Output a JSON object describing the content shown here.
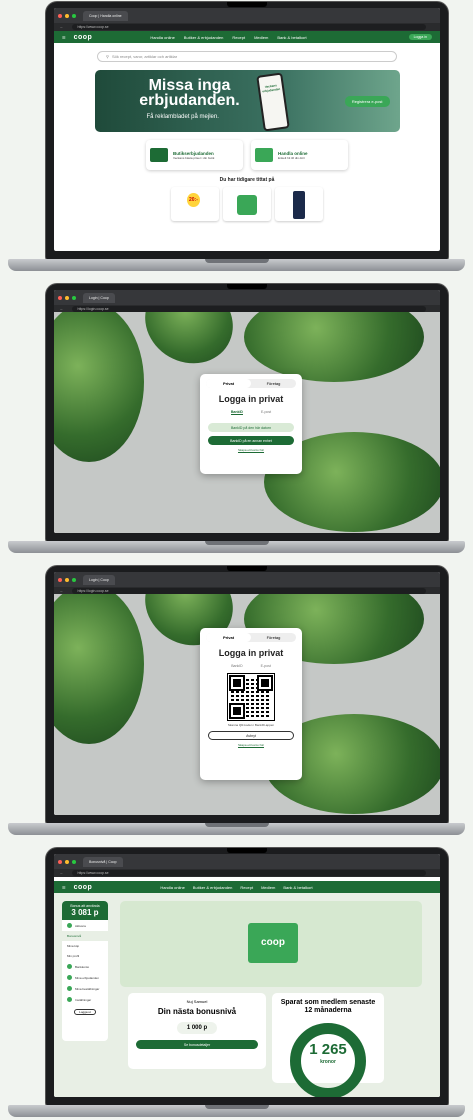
{
  "screen1": {
    "tab": "Coop | Handla online",
    "url": "https://www.coop.se",
    "logo": "coop",
    "nav": [
      "Handla online",
      "Butiker & erbjudanden",
      "Recept",
      "Medlem",
      "Bank & betalkort"
    ],
    "login": "Logga in",
    "search_placeholder": "Sök recept, varor, artiklar och artiklar",
    "hero_title": "Missa inga erbjudanden.",
    "hero_sub": "Få reklambladet på mejlen.",
    "hero_button": "Registrera e-post",
    "phone_text": "Veckans erbjudanden",
    "card1_title": "Butikserbjudanden",
    "card1_sub": "Veckans bästa priser i din butik",
    "card2_title": "Handla online",
    "card2_sub": "Enkelt hit till din dörr",
    "section": "Du har tidigare tittat på",
    "price": "20:-"
  },
  "screen2": {
    "tab": "Login | Coop",
    "url": "https://login.coop.se",
    "seg": [
      "Privat",
      "Företag"
    ],
    "title": "Logga in privat",
    "subtabs": [
      "BankID",
      "E-post"
    ],
    "btn1": "BankID på den här datorn",
    "btn2": "BankID på en annan enhet",
    "link": "Skapa ett konto här"
  },
  "screen3": {
    "tab": "Login | Coop",
    "url": "https://login.coop.se",
    "seg": [
      "Privat",
      "Företag"
    ],
    "title": "Logga in privat",
    "subtabs": [
      "BankID",
      "E-post"
    ],
    "qr_text": "Skanna QR-koden i BankID-appen",
    "cancel": "Avbryt",
    "link": "Skapa ett konto här"
  },
  "screen4": {
    "tab": "Bonusnivå | Coop",
    "url": "https://www.coop.se",
    "logo": "coop",
    "nav": [
      "Handla online",
      "Butiker & erbjudanden",
      "Recept",
      "Medlem",
      "Bank & betalkort"
    ],
    "side_label": "Bonus att använda",
    "side_value": "3 081 p",
    "side_items": [
      "Aktivera",
      "Bonusnivå",
      "Mina köp",
      "Min profil",
      "Bankkonto",
      "Mina erbjudanden",
      "Mina beställningar",
      "Inställningar"
    ],
    "side_button": "Logga ut",
    "banner_logo": "coop",
    "box1_label": "Nuj Samuel",
    "box1_title": "Din nästa bonusnivå",
    "box1_value": "1 000 p",
    "box1_button": "Se bonusdetaljer",
    "box2_title": "Sparat som medlem senaste 12 månaderna",
    "box2_value": "1 265",
    "box2_unit": "kronor"
  }
}
